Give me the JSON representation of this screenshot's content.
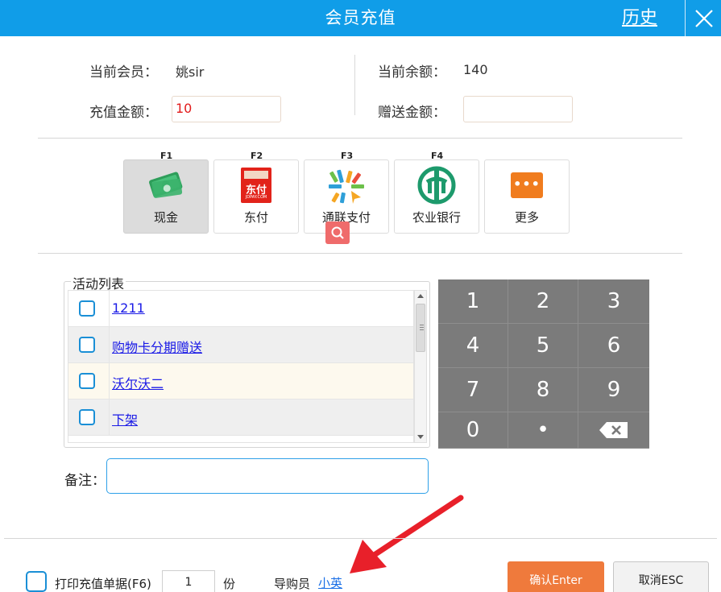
{
  "window": {
    "title": "会员充值",
    "history_label": "历史"
  },
  "member": {
    "current_member_label": "当前会员：",
    "current_member_value": "姚sir",
    "balance_label": "当前余额：",
    "balance_value": "140",
    "recharge_label": "充值金额：",
    "recharge_value": "10",
    "bonus_label": "赠送金额：",
    "bonus_value": ""
  },
  "payments": [
    {
      "key": "F1",
      "label": "现金",
      "icon": "cash-icon",
      "selected": true
    },
    {
      "key": "F2",
      "label": "东付",
      "icon": "dongfu-icon",
      "icon_text": "东付",
      "icon_subtext": "JDPAY.COM"
    },
    {
      "key": "F3",
      "label": "通联支付",
      "icon": "allinpay-icon"
    },
    {
      "key": "F4",
      "label": "农业银行",
      "icon": "abc-bank-icon"
    },
    {
      "key": "",
      "label": "更多",
      "icon": "more-icon",
      "icon_text": "•••"
    }
  ],
  "activities": {
    "legend": "活动列表",
    "items": [
      {
        "label": "1211",
        "checked": false
      },
      {
        "label": "购物卡分期赠送",
        "checked": false
      },
      {
        "label": "沃尔沃二",
        "checked": false
      },
      {
        "label": "下架",
        "checked": false
      }
    ]
  },
  "keypad": {
    "keys": [
      "1",
      "2",
      "3",
      "4",
      "5",
      "6",
      "7",
      "8",
      "9",
      "0",
      "•",
      "backspace"
    ]
  },
  "remark": {
    "label": "备注：",
    "value": ""
  },
  "footer": {
    "print_label": "打印充值单据(F6)",
    "copies_value": "1",
    "copies_unit": "份",
    "guide_label": "导购员",
    "guide_value": "小英",
    "confirm_label": "确认Enter",
    "cancel_label": "取消ESC"
  },
  "colors": {
    "titlebar": "#109de8",
    "confirm": "#ef7a3c",
    "keypad": "#7b7b7b",
    "annotation_arrow": "#e8202a"
  }
}
